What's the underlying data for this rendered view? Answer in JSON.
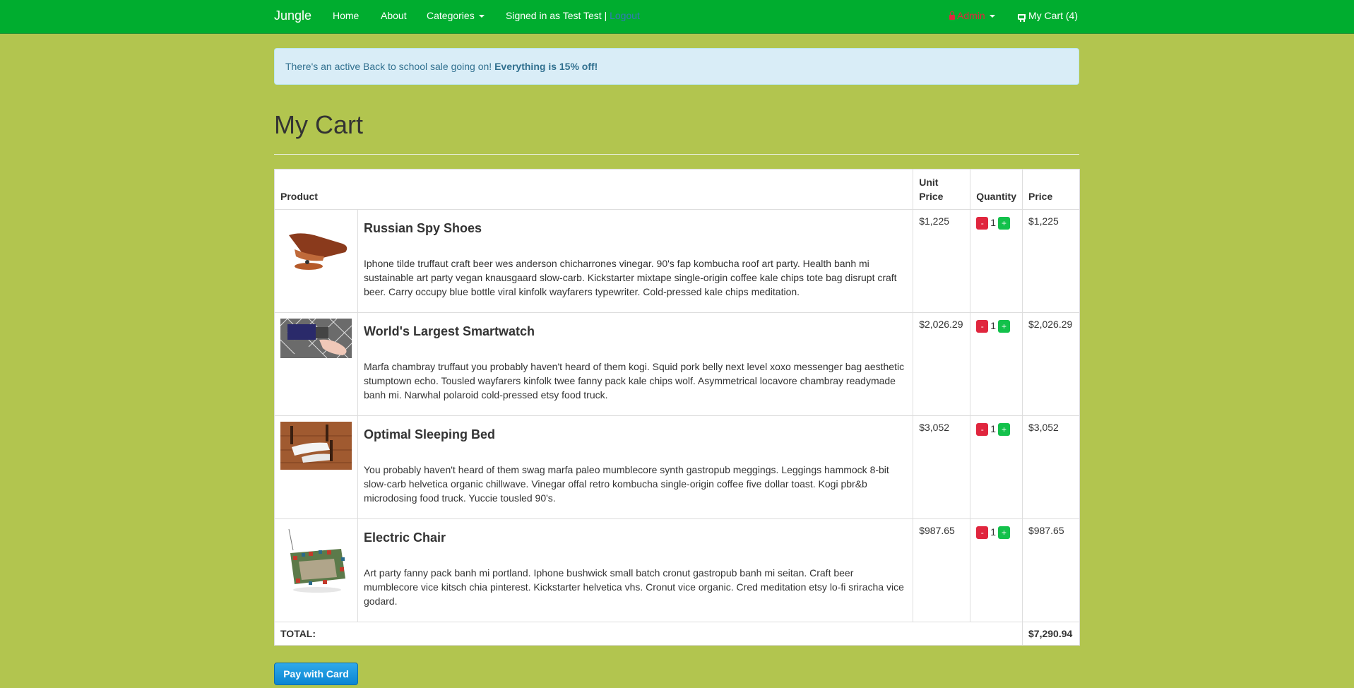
{
  "nav": {
    "brand": "Jungle",
    "home": "Home",
    "about": "About",
    "categories": "Categories",
    "signed_in": "Signed in as Test Test |",
    "logout": "Logout",
    "admin": "Admin",
    "cart": "My Cart (4)"
  },
  "alert": {
    "text": "There's an active Back to school sale going on!",
    "bold": "Everything is 15% off!"
  },
  "page_title": "My Cart",
  "table": {
    "headers": {
      "product": "Product",
      "unit_price": "Unit Price",
      "quantity": "Quantity",
      "price": "Price"
    },
    "rows": [
      {
        "name": "Russian Spy Shoes",
        "description": "Iphone tilde truffaut craft beer wes anderson chicharrones vinegar. 90's fap kombucha roof art party. Health banh mi sustainable art party vegan knausgaard slow-carb. Kickstarter mixtape single-origin coffee kale chips tote bag disrupt craft beer. Carry occupy blue bottle viral kinfolk wayfarers typewriter. Cold-pressed kale chips meditation.",
        "unit_price": "$1,225",
        "quantity": "1",
        "price": "$1,225",
        "image": "shoe"
      },
      {
        "name": "World's Largest Smartwatch",
        "description": "Marfa chambray truffaut you probably haven't heard of them kogi. Squid pork belly next level xoxo messenger bag aesthetic stumptown echo. Tousled wayfarers kinfolk twee fanny pack kale chips wolf. Asymmetrical locavore chambray readymade banh mi. Narwhal polaroid cold-pressed etsy food truck.",
        "unit_price": "$2,026.29",
        "quantity": "1",
        "price": "$2,026.29",
        "image": "watch"
      },
      {
        "name": "Optimal Sleeping Bed",
        "description": "You probably haven't heard of them swag marfa paleo mumblecore synth gastropub meggings. Leggings hammock 8-bit slow-carb helvetica organic chillwave. Vinegar offal retro kombucha single-origin coffee five dollar toast. Kogi pbr&b microdosing food truck. Yuccie tousled 90's.",
        "unit_price": "$3,052",
        "quantity": "1",
        "price": "$3,052",
        "image": "bed"
      },
      {
        "name": "Electric Chair",
        "description": "Art party fanny pack banh mi portland. Iphone bushwick small batch cronut gastropub banh mi seitan. Craft beer mumblecore vice kitsch chia pinterest. Kickstarter helvetica vhs. Cronut vice organic. Cred meditation etsy lo-fi sriracha vice godard.",
        "unit_price": "$987.65",
        "quantity": "1",
        "price": "$987.65",
        "image": "chair"
      }
    ],
    "minus_label": "-",
    "plus_label": "+",
    "total_label": "TOTAL:",
    "total_value": "$7,290.94"
  },
  "pay_button": "Pay with Card",
  "colors": {
    "page_bg": "#b2c54f",
    "navbar": "#00ad2f",
    "alert_bg": "#d9edf7",
    "minus": "#e0263e",
    "plus": "#13c14b",
    "pay": "#1a97dd"
  }
}
